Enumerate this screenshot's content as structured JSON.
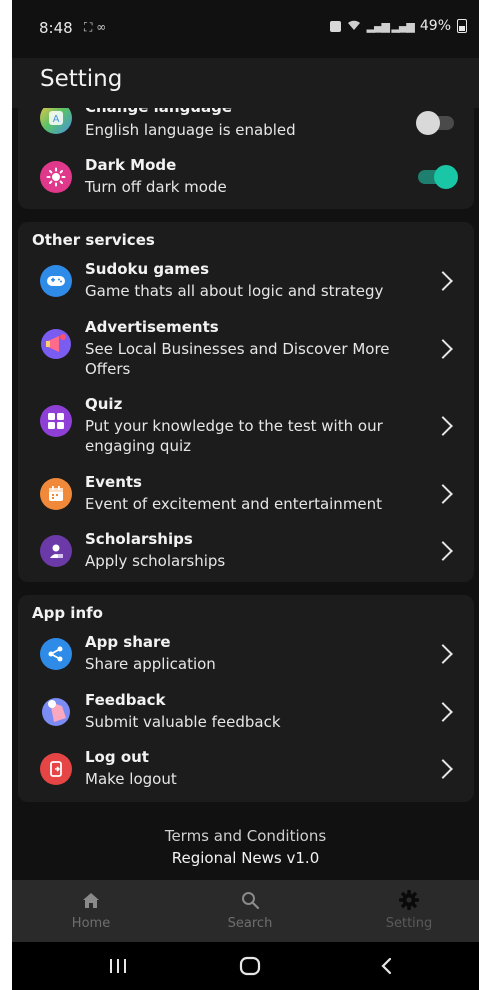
{
  "status": {
    "time": "8:48",
    "battery": "49%"
  },
  "header": {
    "title": "Setting"
  },
  "preferences": {
    "items": [
      {
        "title": "Change language",
        "subtitle": "English language is enabled",
        "icon": "language-icon",
        "toggle": "off"
      },
      {
        "title": "Dark Mode",
        "subtitle": "Turn off dark mode",
        "icon": "sun-icon",
        "toggle": "on"
      }
    ]
  },
  "other_services": {
    "title": "Other services",
    "items": [
      {
        "title": "Sudoku games",
        "subtitle": "Game thats all about logic and strategy",
        "icon": "gamepad-icon"
      },
      {
        "title": "Advertisements",
        "subtitle": "See Local Businesses and Discover More Offers",
        "icon": "megaphone-icon"
      },
      {
        "title": "Quiz",
        "subtitle": "Put your knowledge to the test with our engaging quiz",
        "icon": "quiz-icon"
      },
      {
        "title": "Events",
        "subtitle": "Event of excitement and entertainment",
        "icon": "calendar-icon"
      },
      {
        "title": "Scholarships",
        "subtitle": "Apply scholarships",
        "icon": "scholarship-icon"
      }
    ]
  },
  "app_info": {
    "title": "App info",
    "items": [
      {
        "title": "App share",
        "subtitle": "Share application",
        "icon": "share-icon"
      },
      {
        "title": "Feedback",
        "subtitle": "Submit valuable feedback",
        "icon": "feedback-icon"
      },
      {
        "title": "Log out",
        "subtitle": "Make logout",
        "icon": "logout-icon"
      }
    ]
  },
  "footer": {
    "terms": "Terms and Conditions",
    "version": "Regional News v1.0"
  },
  "bottom_nav": {
    "items": [
      {
        "label": "Home",
        "icon": "home-icon",
        "active": false
      },
      {
        "label": "Search",
        "icon": "search-icon",
        "active": false
      },
      {
        "label": "Setting",
        "icon": "gear-icon",
        "active": true
      }
    ]
  },
  "colors": {
    "background": "#111111",
    "card": "#1c1c1c",
    "toggle_on": "#19c6a6",
    "nav_bg": "#2a2a2a"
  }
}
